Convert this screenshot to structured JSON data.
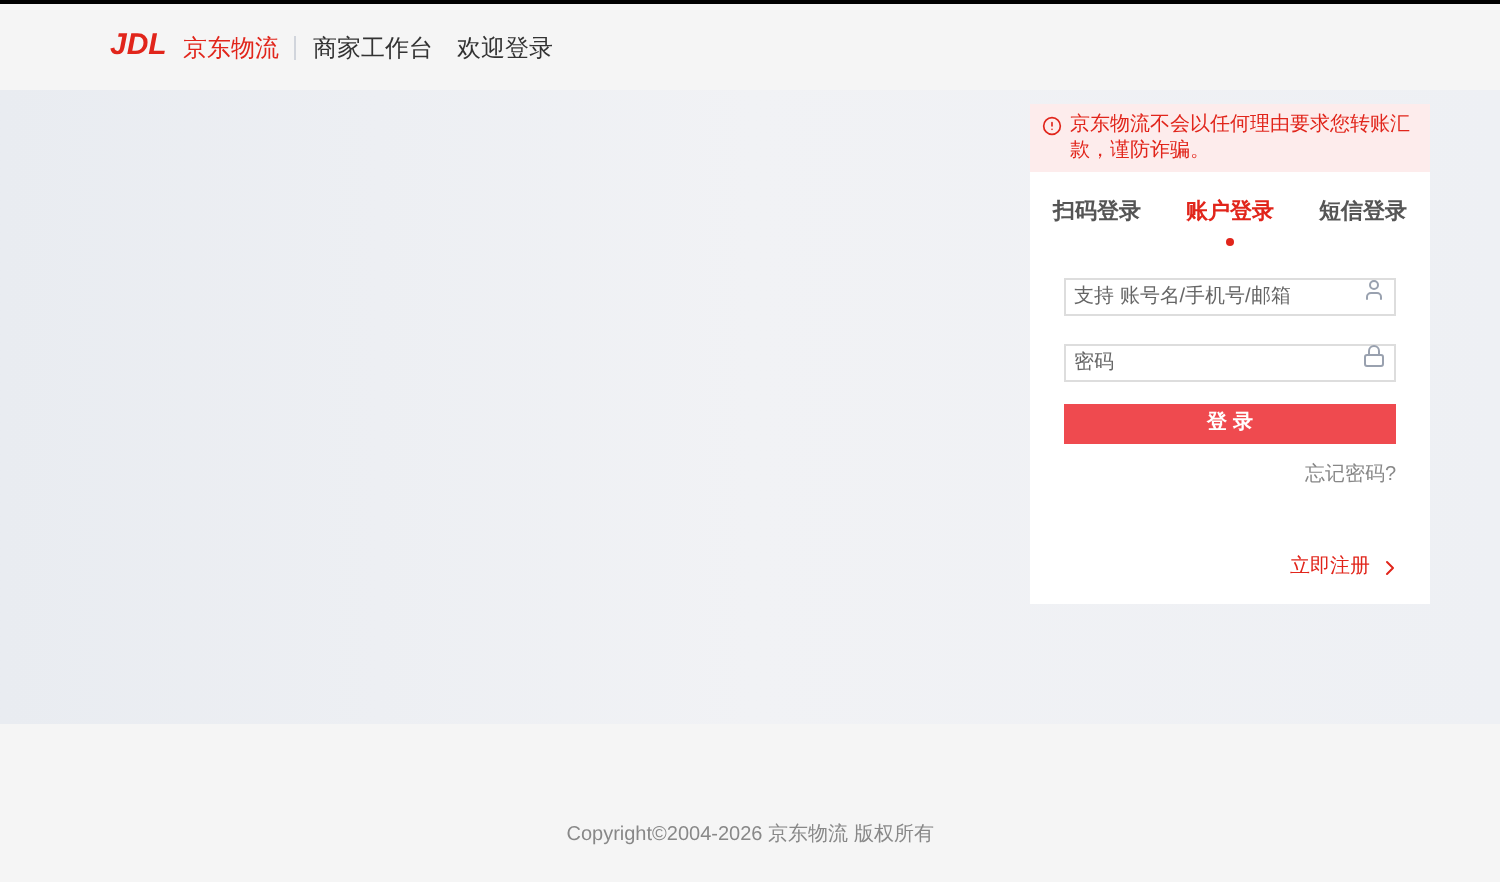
{
  "header": {
    "logo_mark": "JDL",
    "logo_text": "京东物流",
    "product": "商家工作台",
    "page_title": "欢迎登录"
  },
  "login": {
    "notice": "京东物流不会以任何理由要求您转账汇款，谨防诈骗。",
    "tabs": [
      {
        "label": "扫码登录",
        "selected": false
      },
      {
        "label": "账户登录",
        "selected": true
      },
      {
        "label": "短信登录",
        "selected": false
      }
    ],
    "fields": [
      {
        "kind": "user",
        "placeholder": "支持 账号名/手机号/邮箱"
      },
      {
        "kind": "password",
        "placeholder": "密码"
      }
    ],
    "submit": "登 录",
    "forgot": "忘记密码?",
    "register": "立即注册"
  },
  "footer": "Copyright©2004-2026 京东物流 版权所有"
}
